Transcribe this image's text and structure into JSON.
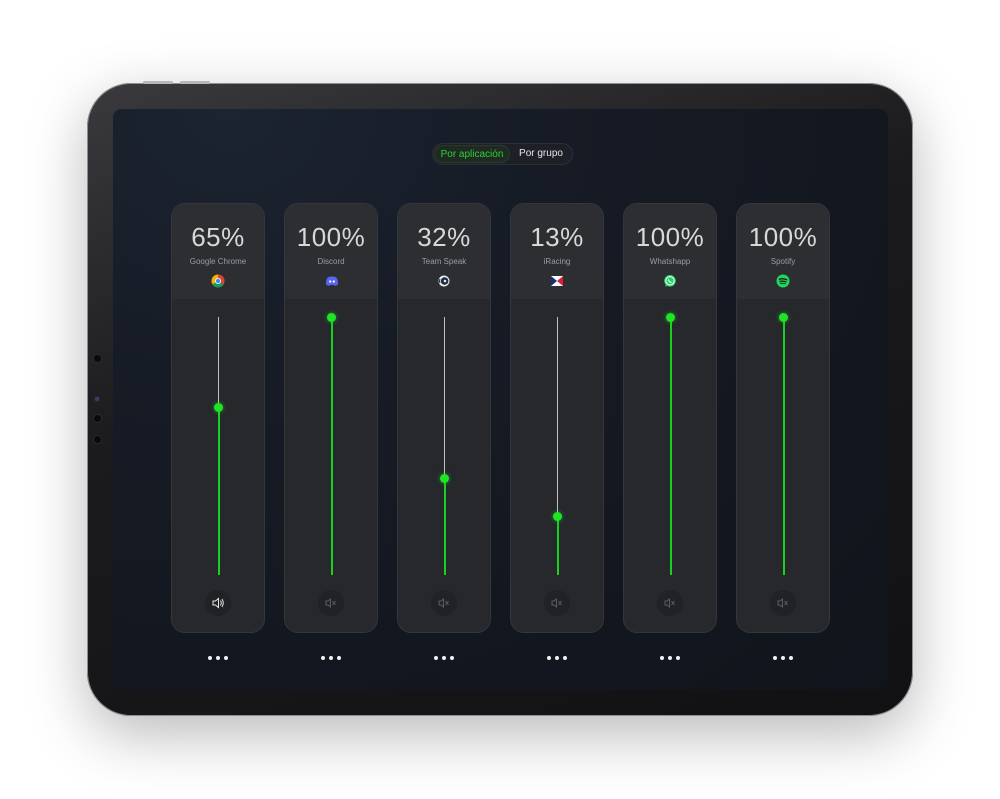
{
  "toggle": {
    "active": "Por aplicación",
    "inactive": "Por grupo"
  },
  "apps": [
    {
      "name": "Google Chrome",
      "percent_label": "65%",
      "level": 0.65,
      "icon": "chrome-icon",
      "muted": false
    },
    {
      "name": "Discord",
      "percent_label": "100%",
      "level": 1.0,
      "icon": "discord-icon",
      "muted": true
    },
    {
      "name": "Team Speak",
      "percent_label": "32%",
      "level": 0.375,
      "icon": "teamspeak-icon",
      "muted": true
    },
    {
      "name": "iRacing",
      "percent_label": "13%",
      "level": 0.225,
      "icon": "iracing-icon",
      "muted": true
    },
    {
      "name": "Whatshapp",
      "percent_label": "100%",
      "level": 1.0,
      "icon": "whatsapp-icon",
      "muted": true
    },
    {
      "name": "Spotify",
      "percent_label": "100%",
      "level": 1.0,
      "icon": "spotify-icon",
      "muted": true
    }
  ],
  "colors": {
    "accent": "#1ee424",
    "card": "#26282c",
    "track": "#bfc0c4"
  },
  "menu_icon": "more-dots-icon"
}
